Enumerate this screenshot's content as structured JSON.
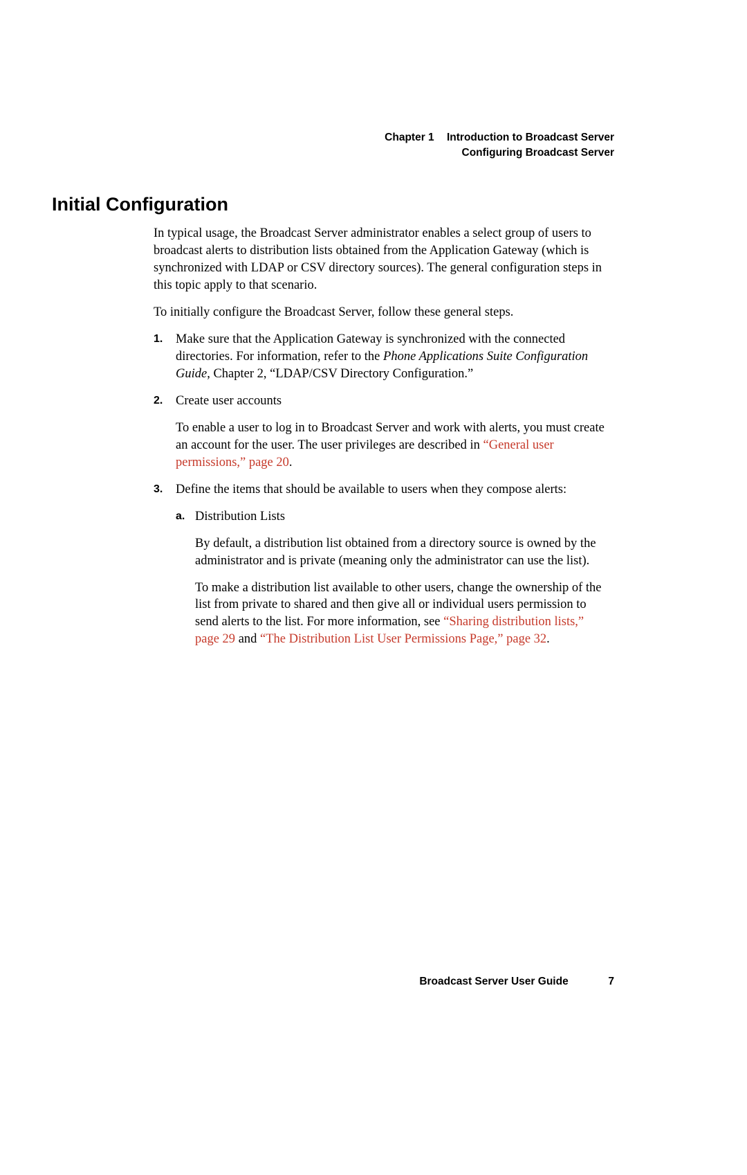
{
  "header": {
    "chapter_label": "Chapter 1",
    "chapter_title": "Introduction to Broadcast Server",
    "section_title": "Configuring Broadcast Server"
  },
  "title": "Initial Configuration",
  "intro1": "In typical usage, the Broadcast Server administrator enables a select group of users to broadcast alerts to distribution lists obtained from the Application Gateway (which is synchronized with LDAP or CSV directory sources). The general configuration steps in this topic apply to that scenario.",
  "intro2": "To initially configure the Broadcast Server, follow these general steps.",
  "steps": {
    "s1": {
      "num": "1.",
      "t1": "Make sure that the Application Gateway is synchronized with the connected directories. For information, refer to the ",
      "t2": "Phone Applications Suite Configuration Guide",
      "t3": ", Chapter 2, “LDAP/CSV Directory Configuration.”"
    },
    "s2": {
      "num": "2.",
      "h": "Create user accounts",
      "p_pre": "To enable a user to log in to Broadcast Server and work with alerts, you must create an account for the user. The user privileges are described in ",
      "link": "“General user permissions,” page 20",
      "p_post": "."
    },
    "s3": {
      "num": "3.",
      "h": "Define the items that should be available to users when they compose alerts:",
      "a": {
        "num": "a.",
        "h": "Distribution Lists",
        "p1": "By default, a distribution list obtained from a directory source is owned by the administrator and is private (meaning only the administrator can use the list).",
        "p2_pre": "To make a distribution list available to other users, change the ownership of the list from private to shared and then give all or individual users permission to send alerts to the list. For more information, see ",
        "link1": "“Sharing distribution lists,” page 29",
        "mid": " and ",
        "link2": "“The Distribution List User Permissions Page,” page 32",
        "post": "."
      }
    }
  },
  "footer": {
    "guide": "Broadcast Server User Guide",
    "page": "7"
  }
}
